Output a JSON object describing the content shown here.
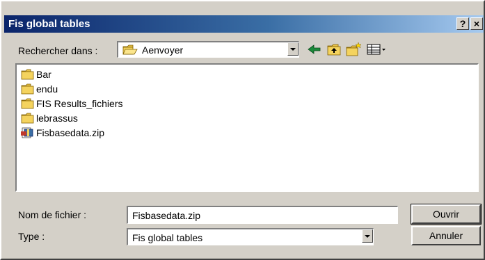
{
  "window": {
    "title": "Fis global tables",
    "help_label": "?",
    "close_label": "×"
  },
  "look_in": {
    "label": "Rechercher dans :",
    "value": "Aenvoyer",
    "icon": "folder-open-icon"
  },
  "toolbar": {
    "icons": [
      "back-arrow-icon",
      "up-folder-icon",
      "new-folder-icon",
      "view-menu-icon"
    ]
  },
  "files": [
    {
      "name": "Bar",
      "icon": "folder-icon"
    },
    {
      "name": "endu",
      "icon": "folder-icon"
    },
    {
      "name": "FIS Results_fichiers",
      "icon": "folder-icon"
    },
    {
      "name": "lebrassus",
      "icon": "folder-icon"
    },
    {
      "name": "Fisbasedata.zip",
      "icon": "zip-file-icon"
    }
  ],
  "filename": {
    "label": "Nom de fichier :",
    "value": "Fisbasedata.zip"
  },
  "filetype": {
    "label": "Type :",
    "value": "Fis global tables"
  },
  "buttons": {
    "open": "Ouvrir",
    "cancel": "Annuler"
  },
  "colors": {
    "title_bar_start": "#0a246a",
    "title_bar_end": "#a6caf0",
    "face": "#d4d0c8",
    "folder": "#f4d35e"
  }
}
